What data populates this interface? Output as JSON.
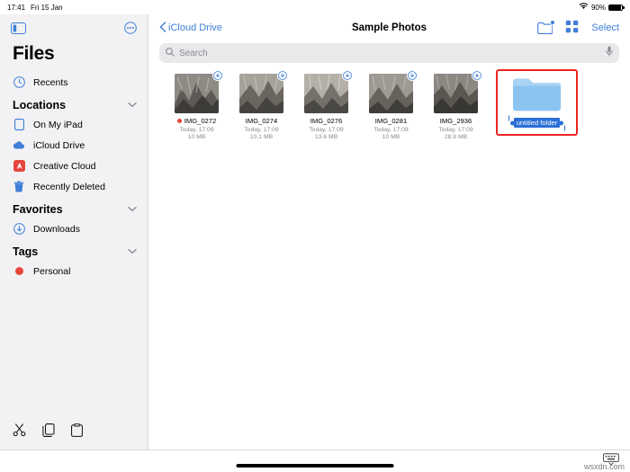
{
  "status": {
    "time": "17:41",
    "date": "Fri 15 Jan",
    "wifi_icon": "wifi-icon",
    "battery_percent": "90%",
    "battery_level": 0.9
  },
  "sidebar": {
    "toggle_icon": "sidebar-toggle-icon",
    "more_icon": "more-circle-icon",
    "title": "Files",
    "recents": {
      "label": "Recents",
      "icon": "clock-icon"
    },
    "sections": [
      {
        "title": "Locations",
        "chevron": "chevron-down-icon",
        "items": [
          {
            "label": "On My iPad",
            "icon": "ipad-icon"
          },
          {
            "label": "iCloud Drive",
            "icon": "cloud-icon"
          },
          {
            "label": "Creative Cloud",
            "icon": "creative-cloud-icon"
          },
          {
            "label": "Recently Deleted",
            "icon": "trash-icon"
          }
        ]
      },
      {
        "title": "Favorites",
        "chevron": "chevron-down-icon",
        "items": [
          {
            "label": "Downloads",
            "icon": "download-icon"
          }
        ]
      },
      {
        "title": "Tags",
        "chevron": "chevron-down-icon",
        "items": [
          {
            "label": "Personal",
            "icon": "red-dot-icon"
          }
        ]
      }
    ],
    "bottom_tools": [
      {
        "name": "cut-icon",
        "label": "Cut"
      },
      {
        "name": "copy-icon",
        "label": "Copy"
      },
      {
        "name": "paste-icon",
        "label": "Paste"
      }
    ]
  },
  "nav": {
    "back_label": "iCloud Drive",
    "back_icon": "chevron-left-icon",
    "title": "Sample Photos",
    "new_folder_icon": "new-folder-icon",
    "grid_view_icon": "grid-view-icon",
    "select_label": "Select"
  },
  "search": {
    "placeholder": "Search",
    "search_icon": "search-icon",
    "mic_icon": "microphone-icon"
  },
  "files": [
    {
      "name": "IMG_0272",
      "date": "Today, 17:09",
      "size": "10 MB",
      "tag": "red",
      "badge": "icloud-download-icon"
    },
    {
      "name": "IMG_0274",
      "date": "Today, 17:09",
      "size": "10.1 MB",
      "tag": "none",
      "badge": "icloud-download-icon"
    },
    {
      "name": "IMG_0276",
      "date": "Today, 17:09",
      "size": "13.6 MB",
      "tag": "none",
      "badge": "icloud-download-icon"
    },
    {
      "name": "IMG_0281",
      "date": "Today, 17:09",
      "size": "10 MB",
      "tag": "none",
      "badge": "icloud-download-icon"
    },
    {
      "name": "IMG_2936",
      "date": "Today, 17:09",
      "size": "28.9 MB",
      "tag": "none",
      "badge": "icloud-download-icon"
    }
  ],
  "new_folder": {
    "icon": "folder-icon",
    "name_value": "untitled folder",
    "selected": true,
    "highlight_color": "#ee2222",
    "selection_color": "#2a6fd6"
  },
  "bottom": {
    "keyboard_icon": "keyboard-hide-icon",
    "watermark": "wsxdn.com"
  }
}
